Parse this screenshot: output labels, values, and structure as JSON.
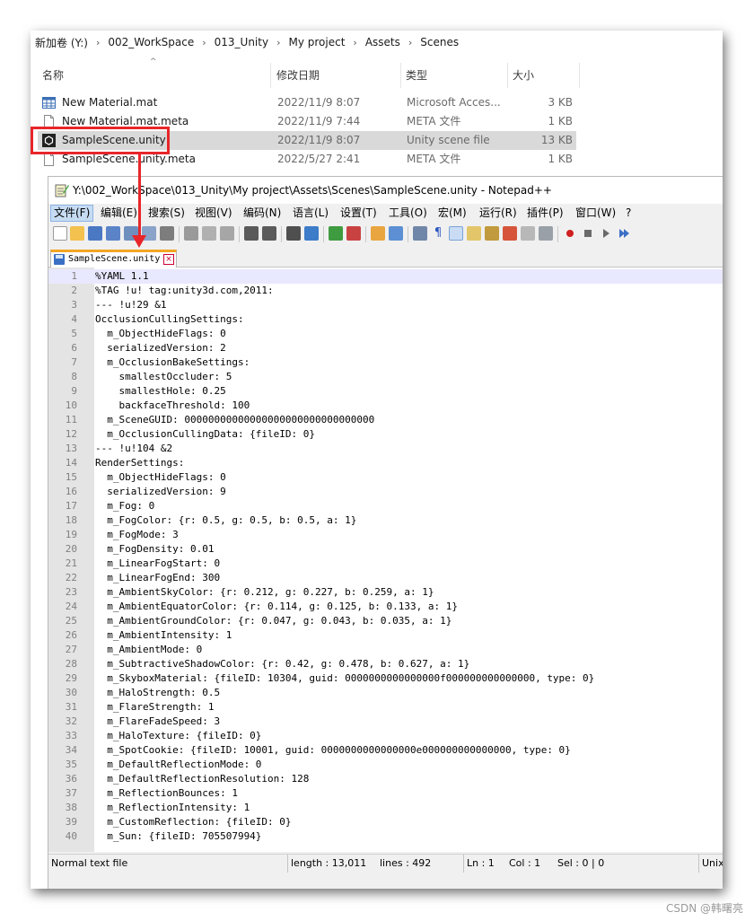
{
  "explorer": {
    "breadcrumb": [
      "新加卷 (Y:)",
      "002_WorkSpace",
      "013_Unity",
      "My project",
      "Assets",
      "Scenes"
    ],
    "columns": {
      "name": "名称",
      "date": "修改日期",
      "type": "类型",
      "size": "大小"
    },
    "files": [
      {
        "name": "New Material.mat",
        "date": "2022/11/9 8:07",
        "type": "Microsoft Acces...",
        "size": "3 KB",
        "icon": "table-icon"
      },
      {
        "name": "New Material.mat.meta",
        "date": "2022/11/9 7:44",
        "type": "META 文件",
        "size": "1 KB",
        "icon": "file-icon"
      },
      {
        "name": "SampleScene.unity",
        "date": "2022/11/9 8:07",
        "type": "Unity scene file",
        "size": "13 KB",
        "icon": "unity-icon"
      },
      {
        "name": "SampleScene.unity.meta",
        "date": "2022/5/27 2:41",
        "type": "META 文件",
        "size": "1 KB",
        "icon": "file-icon"
      }
    ],
    "highlight_color": "#e8262a"
  },
  "notepad": {
    "title": "Y:\\002_WorkSpace\\013_Unity\\My project\\Assets\\Scenes\\SampleScene.unity - Notepad++",
    "menu": [
      "文件(F)",
      "编辑(E)",
      "搜索(S)",
      "视图(V)",
      "编码(N)",
      "语言(L)",
      "设置(T)",
      "工具(O)",
      "宏(M)",
      "运行(R)",
      "插件(P)",
      "窗口(W)",
      "?"
    ],
    "tab_label": "SampleScene.unity",
    "lines": [
      "%YAML 1.1",
      "%TAG !u! tag:unity3d.com,2011:",
      "--- !u!29 &1",
      "OcclusionCullingSettings:",
      "  m_ObjectHideFlags: 0",
      "  serializedVersion: 2",
      "  m_OcclusionBakeSettings:",
      "    smallestOccluder: 5",
      "    smallestHole: 0.25",
      "    backfaceThreshold: 100",
      "  m_SceneGUID: 00000000000000000000000000000000",
      "  m_OcclusionCullingData: {fileID: 0}",
      "--- !u!104 &2",
      "RenderSettings:",
      "  m_ObjectHideFlags: 0",
      "  serializedVersion: 9",
      "  m_Fog: 0",
      "  m_FogColor: {r: 0.5, g: 0.5, b: 0.5, a: 1}",
      "  m_FogMode: 3",
      "  m_FogDensity: 0.01",
      "  m_LinearFogStart: 0",
      "  m_LinearFogEnd: 300",
      "  m_AmbientSkyColor: {r: 0.212, g: 0.227, b: 0.259, a: 1}",
      "  m_AmbientEquatorColor: {r: 0.114, g: 0.125, b: 0.133, a: 1}",
      "  m_AmbientGroundColor: {r: 0.047, g: 0.043, b: 0.035, a: 1}",
      "  m_AmbientIntensity: 1",
      "  m_AmbientMode: 0",
      "  m_SubtractiveShadowColor: {r: 0.42, g: 0.478, b: 0.627, a: 1}",
      "  m_SkyboxMaterial: {fileID: 10304, guid: 0000000000000000f000000000000000, type: 0}",
      "  m_HaloStrength: 0.5",
      "  m_FlareStrength: 1",
      "  m_FlareFadeSpeed: 3",
      "  m_HaloTexture: {fileID: 0}",
      "  m_SpotCookie: {fileID: 10001, guid: 0000000000000000e000000000000000, type: 0}",
      "  m_DefaultReflectionMode: 0",
      "  m_DefaultReflectionResolution: 128",
      "  m_ReflectionBounces: 1",
      "  m_ReflectionIntensity: 1",
      "  m_CustomReflection: {fileID: 0}",
      "  m_Sun: {fileID: 705507994}"
    ],
    "status": {
      "type": "Normal text file",
      "length": "length : 13,011",
      "lines": "lines : 492",
      "ln": "Ln : 1",
      "col": "Col : 1",
      "sel": "Sel : 0 | 0",
      "eol": "Unix"
    }
  },
  "watermark": "CSDN @韩曙亮"
}
